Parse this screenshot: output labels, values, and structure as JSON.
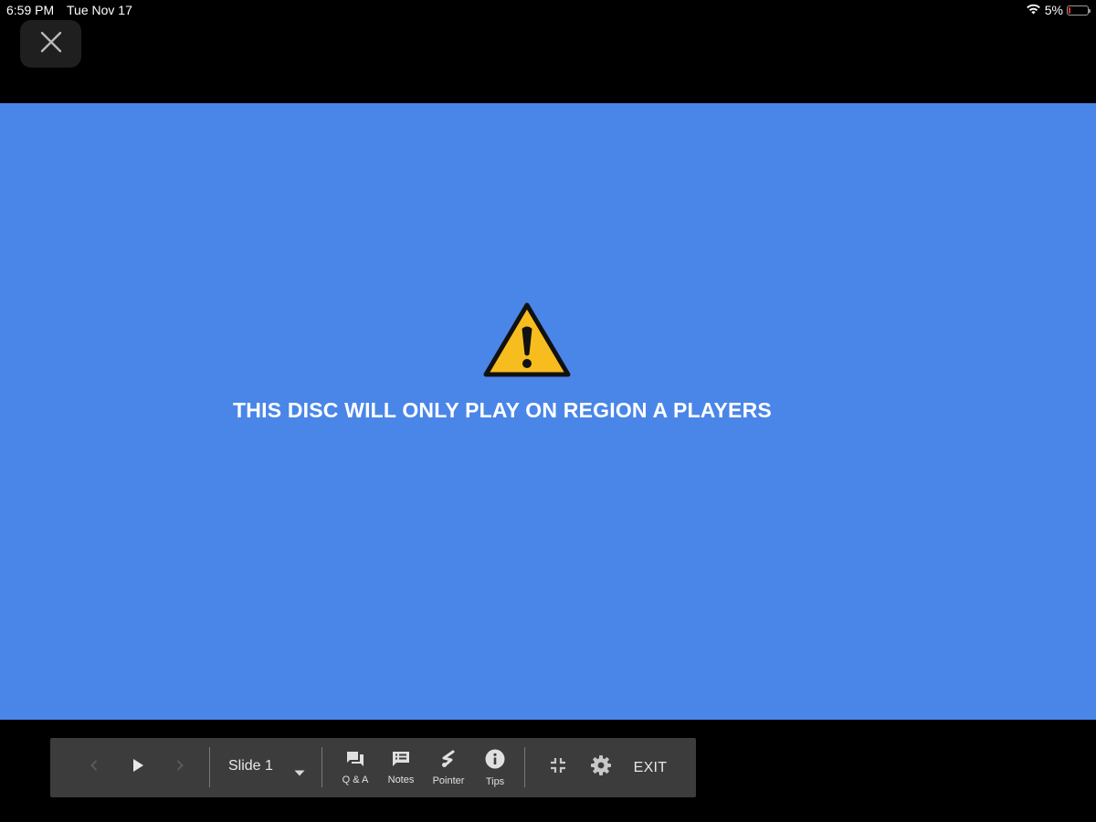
{
  "status_bar": {
    "time": "6:59 PM",
    "date": "Tue Nov 17",
    "battery_percent": "5%",
    "battery_level": 0.05,
    "wifi_icon": "wifi-icon"
  },
  "close_button": {
    "icon": "close-icon"
  },
  "slide": {
    "background_color": "#4a86e8",
    "icon": "warning-icon",
    "text": "THIS DISC WILL ONLY PLAY ON REGION A PLAYERS"
  },
  "toolbar": {
    "prev_icon": "chevron-left-icon",
    "play_icon": "play-icon",
    "next_icon": "chevron-right-icon",
    "slide_select": {
      "value": "Slide 1",
      "icon": "caret-down-icon"
    },
    "qa": {
      "label": "Q & A",
      "icon": "chat-icon"
    },
    "notes": {
      "label": "Notes",
      "icon": "notes-icon"
    },
    "pointer": {
      "label": "Pointer",
      "icon": "pointer-icon"
    },
    "tips": {
      "label": "Tips",
      "icon": "info-icon"
    },
    "exit_fullscreen_icon": "exit-fullscreen-icon",
    "settings_icon": "gear-icon",
    "exit_label": "EXIT"
  }
}
